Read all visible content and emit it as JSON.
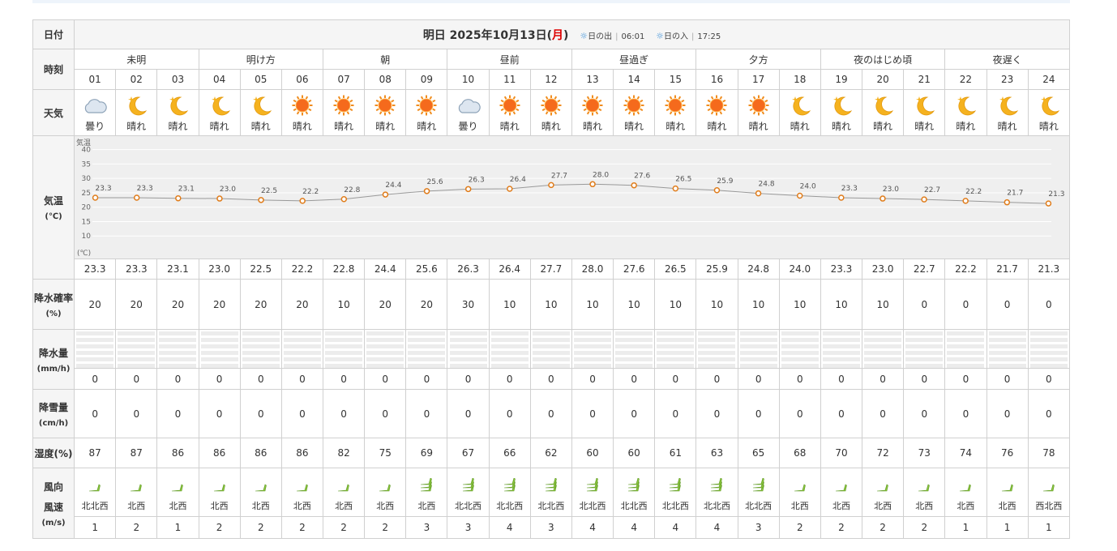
{
  "labels": {
    "date": "日付",
    "time": "時刻",
    "weather": "天気",
    "temp": "気温",
    "temp_unit": "(℃)",
    "pop": "降水確率",
    "pop_unit": "(%)",
    "rain": "降水量",
    "rain_unit": "(mm/h)",
    "snow": "降雪量",
    "snow_unit": "(cm/h)",
    "humidity": "湿度(%)",
    "wind_dir": "風向",
    "wind_speed": "風速",
    "wind_unit": "(m/s)"
  },
  "header": {
    "title_prefix": "明日 2025年10月13日(",
    "dow": "月",
    "title_suffix": ")",
    "sunrise_label": "日の出",
    "sunrise_time": "06:01",
    "sunset_label": "日の入",
    "sunset_time": "17:25",
    "sun_sep": "|"
  },
  "periods": [
    "未明",
    "明け方",
    "朝",
    "昼前",
    "昼過ぎ",
    "夕方",
    "夜のはじめ頃",
    "夜遅く"
  ],
  "hours": [
    "01",
    "02",
    "03",
    "04",
    "05",
    "06",
    "07",
    "08",
    "09",
    "10",
    "11",
    "12",
    "13",
    "14",
    "15",
    "16",
    "17",
    "18",
    "19",
    "20",
    "21",
    "22",
    "23",
    "24"
  ],
  "weather": [
    {
      "label": "曇り",
      "icon": "cloud-icon"
    },
    {
      "label": "晴れ",
      "icon": "moon-icon"
    },
    {
      "label": "晴れ",
      "icon": "moon-icon"
    },
    {
      "label": "晴れ",
      "icon": "moon-icon"
    },
    {
      "label": "晴れ",
      "icon": "moon-icon"
    },
    {
      "label": "晴れ",
      "icon": "sun-icon"
    },
    {
      "label": "晴れ",
      "icon": "sun-icon"
    },
    {
      "label": "晴れ",
      "icon": "sun-icon"
    },
    {
      "label": "晴れ",
      "icon": "sun-icon"
    },
    {
      "label": "曇り",
      "icon": "cloud-icon"
    },
    {
      "label": "晴れ",
      "icon": "sun-icon"
    },
    {
      "label": "晴れ",
      "icon": "sun-icon"
    },
    {
      "label": "晴れ",
      "icon": "sun-icon"
    },
    {
      "label": "晴れ",
      "icon": "sun-icon"
    },
    {
      "label": "晴れ",
      "icon": "sun-icon"
    },
    {
      "label": "晴れ",
      "icon": "sun-icon"
    },
    {
      "label": "晴れ",
      "icon": "sun-icon"
    },
    {
      "label": "晴れ",
      "icon": "moon-icon"
    },
    {
      "label": "晴れ",
      "icon": "moon-icon"
    },
    {
      "label": "晴れ",
      "icon": "moon-icon"
    },
    {
      "label": "晴れ",
      "icon": "moon-icon"
    },
    {
      "label": "晴れ",
      "icon": "moon-icon"
    },
    {
      "label": "晴れ",
      "icon": "moon-icon"
    },
    {
      "label": "晴れ",
      "icon": "moon-icon"
    }
  ],
  "temps": [
    "23.3",
    "23.3",
    "23.1",
    "23.0",
    "22.5",
    "22.2",
    "22.8",
    "24.4",
    "25.6",
    "26.3",
    "26.4",
    "27.7",
    "28.0",
    "27.6",
    "26.5",
    "25.9",
    "24.8",
    "24.0",
    "23.3",
    "23.0",
    "22.7",
    "22.2",
    "21.7",
    "21.3"
  ],
  "pop": [
    "20",
    "20",
    "20",
    "20",
    "20",
    "20",
    "10",
    "20",
    "20",
    "30",
    "10",
    "10",
    "10",
    "10",
    "10",
    "10",
    "10",
    "10",
    "10",
    "10",
    "0",
    "0",
    "0",
    "0"
  ],
  "rain": [
    "0",
    "0",
    "0",
    "0",
    "0",
    "0",
    "0",
    "0",
    "0",
    "0",
    "0",
    "0",
    "0",
    "0",
    "0",
    "0",
    "0",
    "0",
    "0",
    "0",
    "0",
    "0",
    "0",
    "0"
  ],
  "snow": [
    "0",
    "0",
    "0",
    "0",
    "0",
    "0",
    "0",
    "0",
    "0",
    "0",
    "0",
    "0",
    "0",
    "0",
    "0",
    "0",
    "0",
    "0",
    "0",
    "0",
    "0",
    "0",
    "0",
    "0"
  ],
  "humidity": [
    "87",
    "87",
    "86",
    "86",
    "86",
    "86",
    "82",
    "75",
    "69",
    "67",
    "66",
    "62",
    "60",
    "60",
    "61",
    "63",
    "65",
    "68",
    "70",
    "72",
    "73",
    "74",
    "76",
    "78"
  ],
  "wind_dir": [
    "北北西",
    "北西",
    "北西",
    "北西",
    "北西",
    "北西",
    "北西",
    "北西",
    "北西",
    "北北西",
    "北北西",
    "北北西",
    "北北西",
    "北北西",
    "北北西",
    "北北西",
    "北北西",
    "北西",
    "北西",
    "北西",
    "北西",
    "北西",
    "北西",
    "西北西"
  ],
  "wind_speed": [
    "1",
    "2",
    "1",
    "2",
    "2",
    "2",
    "2",
    "2",
    "3",
    "3",
    "4",
    "3",
    "4",
    "4",
    "4",
    "4",
    "3",
    "2",
    "2",
    "2",
    "2",
    "1",
    "1",
    "1"
  ],
  "chart_data": {
    "type": "line",
    "ylabel": "気温",
    "yunit": "(℃)",
    "yticks": [
      10,
      15,
      20,
      25,
      30,
      35,
      40
    ],
    "ylim": [
      5,
      43
    ],
    "x": [
      "01",
      "02",
      "03",
      "04",
      "05",
      "06",
      "07",
      "08",
      "09",
      "10",
      "11",
      "12",
      "13",
      "14",
      "15",
      "16",
      "17",
      "18",
      "19",
      "20",
      "21",
      "22",
      "23",
      "24"
    ],
    "series": [
      {
        "values": [
          23.3,
          23.3,
          23.1,
          23.0,
          22.5,
          22.2,
          22.8,
          24.4,
          25.6,
          26.3,
          26.4,
          27.7,
          28.0,
          27.6,
          26.5,
          25.9,
          24.8,
          24.0,
          23.3,
          23.0,
          22.7,
          22.2,
          21.7,
          21.3
        ]
      }
    ],
    "colors": {
      "line": "#999999",
      "point": "#e07c1a",
      "bg": "#efefef",
      "grid": "#ffffff"
    }
  }
}
